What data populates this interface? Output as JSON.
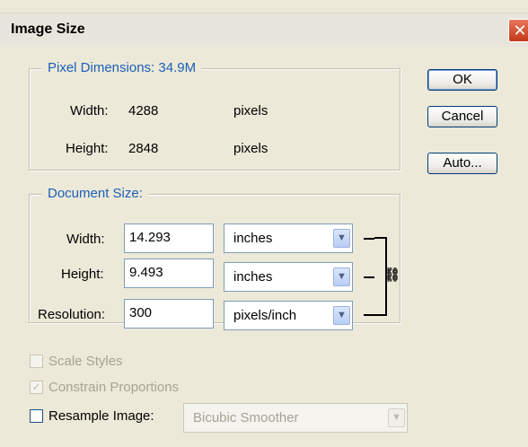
{
  "window": {
    "title": "Image Size",
    "close_glyph": "✕"
  },
  "pixel_dimensions": {
    "legend": "Pixel Dimensions:",
    "size": "34.9M",
    "width_label": "Width:",
    "width_value": "4288",
    "width_unit": "pixels",
    "height_label": "Height:",
    "height_value": "2848",
    "height_unit": "pixels"
  },
  "document_size": {
    "legend": "Document Size:",
    "width_label": "Width:",
    "width_value": "14.293",
    "width_unit": "inches",
    "height_label": "Height:",
    "height_value": "9.493",
    "height_unit": "inches",
    "resolution_label": "Resolution:",
    "resolution_value": "300",
    "resolution_unit": "pixels/inch"
  },
  "buttons": {
    "ok": "OK",
    "cancel": "Cancel",
    "auto": "Auto..."
  },
  "options": {
    "scale_styles": "Scale Styles",
    "scale_styles_checked": false,
    "constrain": "Constrain Proportions",
    "constrain_checked": true,
    "resample": "Resample Image:",
    "resample_checked": false,
    "resample_method": "Bicubic Smoother"
  },
  "icons": {
    "dropdown": "chevron-down-icon",
    "link": "chain-link-icon",
    "check": "checkmark-icon"
  },
  "colors": {
    "legend_text": "#1c5fb8",
    "dialog_bg": "#ece9d8",
    "close_button": "#c2391b"
  }
}
